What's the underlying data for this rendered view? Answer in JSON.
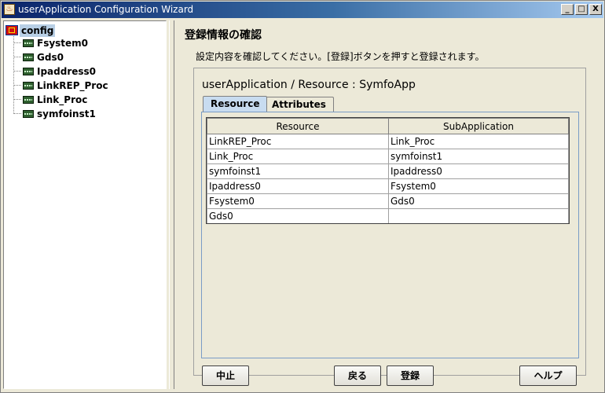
{
  "window": {
    "title": "userApplication Configuration Wizard",
    "controls": {
      "minimize": "_",
      "maximize": "□",
      "close": "X"
    }
  },
  "tree": {
    "root": "config",
    "children": [
      "Fsystem0",
      "Gds0",
      "Ipaddress0",
      "LinkREP_Proc",
      "Link_Proc",
      "symfoinst1"
    ]
  },
  "page": {
    "title": "登録情報の確認",
    "instruction": "設定内容を確認してください。[登録]ボタンを押すと登録されます。"
  },
  "resource_panel": {
    "heading": "userApplication / Resource  :  SymfoApp",
    "tabs": [
      "Resource",
      "Attributes"
    ],
    "active_tab": "Resource"
  },
  "table": {
    "columns": [
      "Resource",
      "SubApplication"
    ],
    "rows": [
      [
        "LinkREP_Proc",
        "Link_Proc"
      ],
      [
        "Link_Proc",
        "symfoinst1"
      ],
      [
        "symfoinst1",
        "Ipaddress0"
      ],
      [
        "Ipaddress0",
        "Fsystem0"
      ],
      [
        "Fsystem0",
        "Gds0"
      ],
      [
        "Gds0",
        ""
      ]
    ]
  },
  "buttons": {
    "cancel": "中止",
    "back": "戻る",
    "register": "登録",
    "help": "ヘルプ"
  },
  "colors": {
    "title_bar_start": "#0a246a",
    "title_bar_end": "#a6caf0",
    "window_bg": "#ece9d8",
    "active_tab": "#c8dcf0",
    "tree_selection": "#b8cfe5"
  }
}
